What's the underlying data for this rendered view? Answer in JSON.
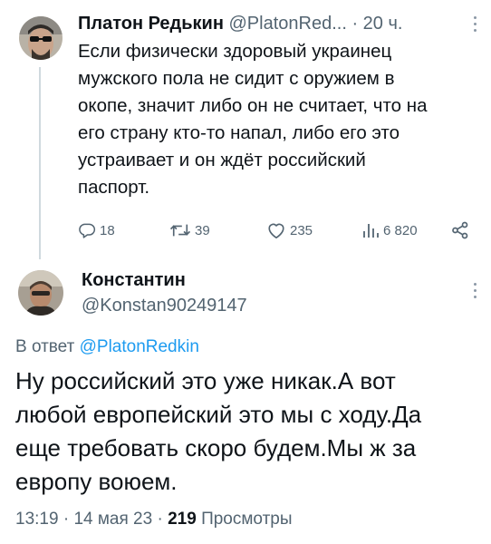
{
  "tweet": {
    "author_name": "Платон Редькин",
    "author_handle": "@PlatonRed...",
    "separator": "·",
    "time_ago": "20 ч.",
    "text": "Если физически здоровый украинец\nмужского пола не сидит с оружием в\nокопе, значит либо он не считает, что на\nего страну кто-то напал, либо его это\nустраивает и он ждёт российский\nпаспорт.",
    "stats": {
      "replies": "18",
      "retweets": "39",
      "likes": "235",
      "views": "6 820"
    }
  },
  "reply": {
    "author_name": "Константин",
    "author_handle": "@Konstan90249147",
    "reply_prefix": "В ответ",
    "reply_to": "@PlatonRedkin",
    "text": "Ну российский это уже никак.А вот\nлюбой европейский это мы с ходу.Да\nеще требовать скоро будем.Мы ж за\nевропу воюем.",
    "time": "13:19",
    "dot": "·",
    "date": "14 мая 23",
    "view_count": "219",
    "views_label": "Просмотры"
  },
  "colors": {
    "text": "#0f1419",
    "secondary": "#536471",
    "link": "#1d9bf0",
    "thread_line": "#cfd9de"
  },
  "icons": [
    "reply-icon",
    "retweet-icon",
    "like-icon",
    "views-icon",
    "share-icon",
    "more-icon"
  ]
}
